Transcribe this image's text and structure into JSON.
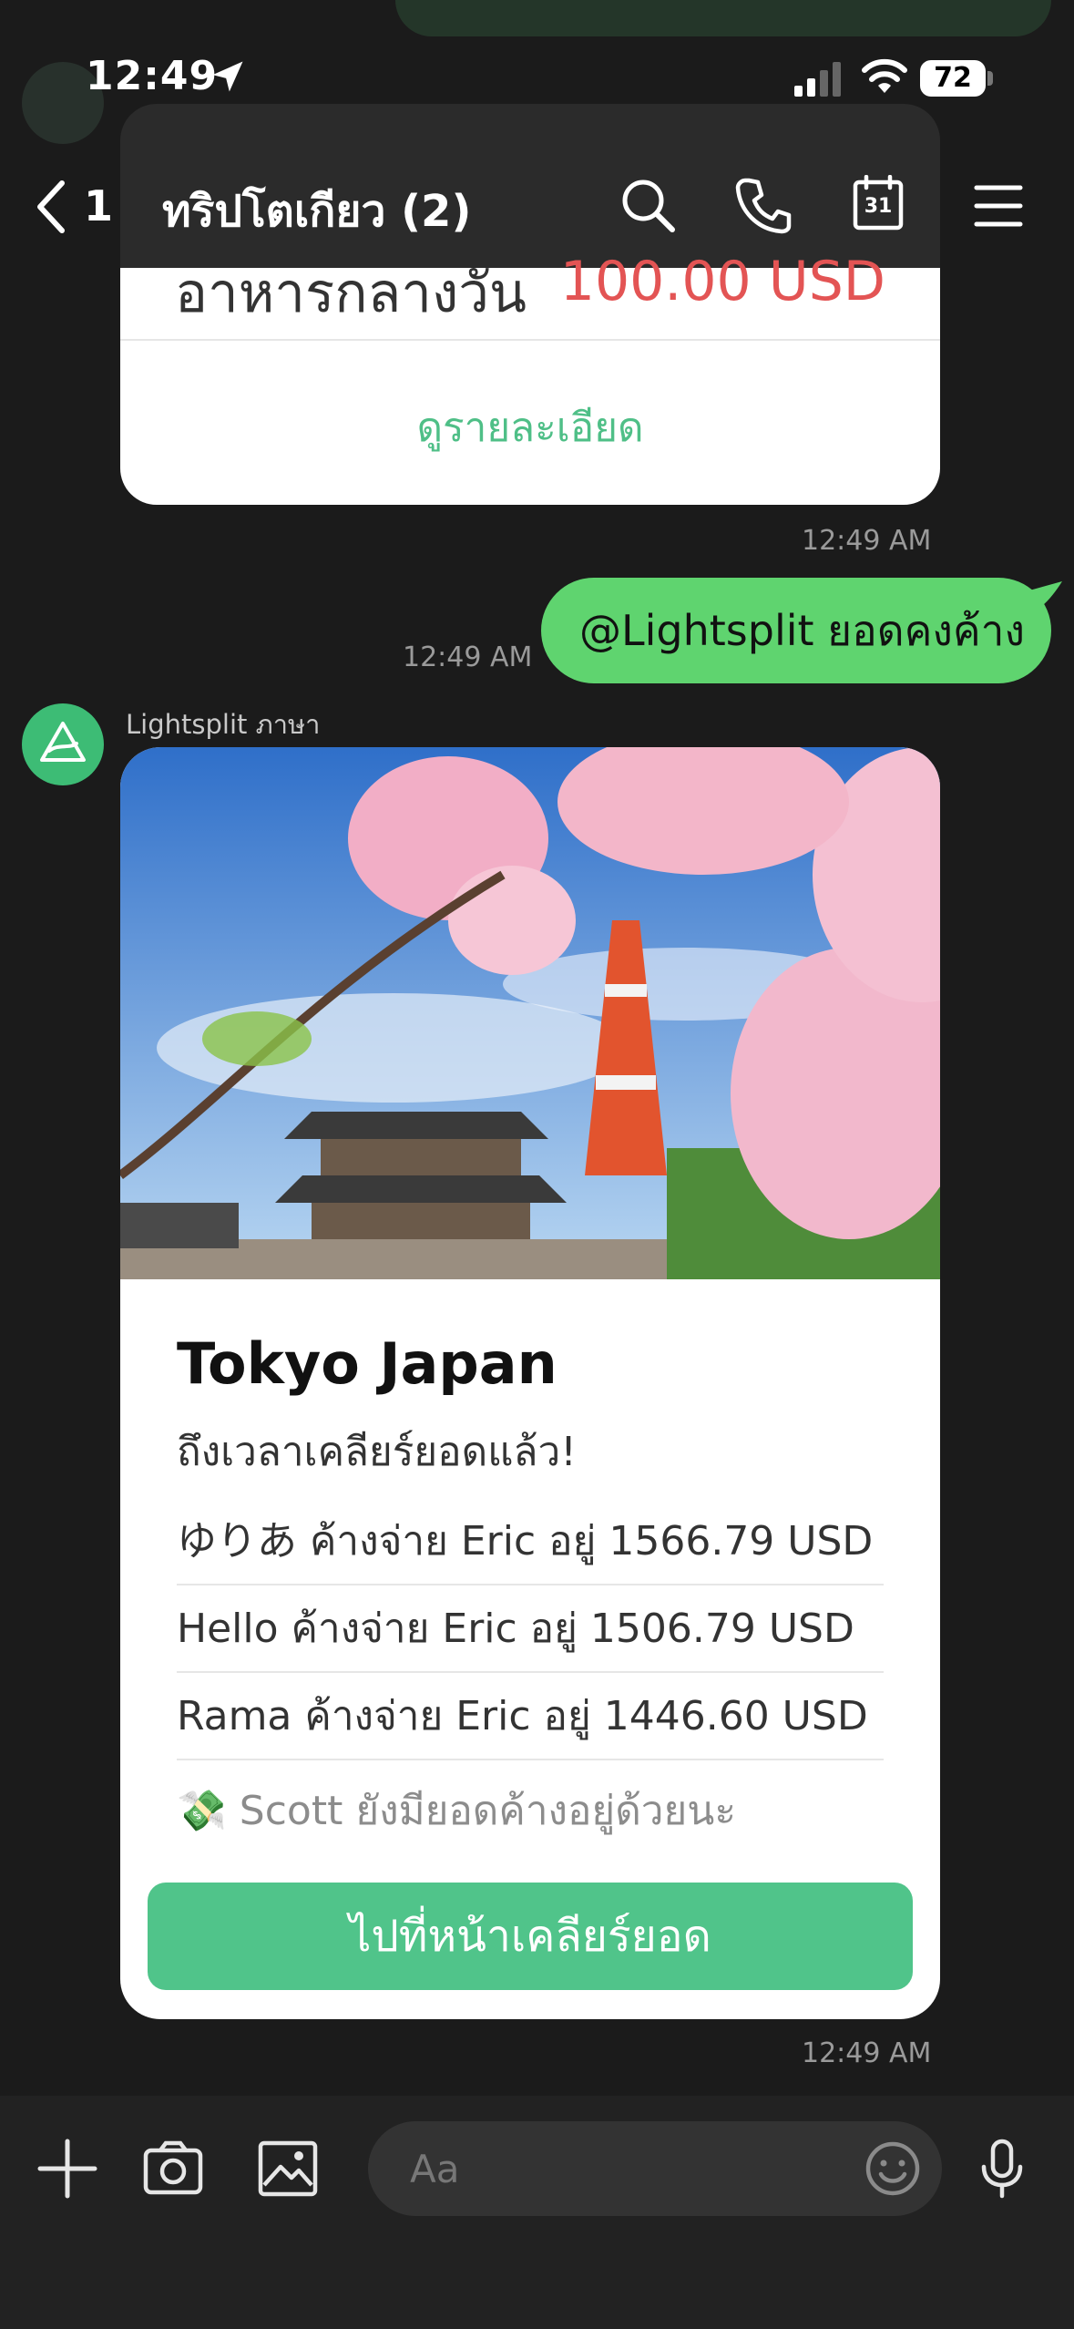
{
  "status_bar": {
    "time": "12:49",
    "battery": "72"
  },
  "header": {
    "back_count": "1",
    "title": "ทริปโตเกียว (2)",
    "calendar_day": "31"
  },
  "top_card": {
    "label": "อาหารกลางวัน",
    "amount": "100.00 USD",
    "link": "ดูรายละเอียด",
    "time": "12:49 AM"
  },
  "sent_message": {
    "text": "@Lightsplit ยอดคงค้าง",
    "time": "12:49 AM"
  },
  "bot": {
    "name": "Lightsplit ภาษา"
  },
  "card": {
    "title": "Tokyo Japan",
    "subtitle": "ถึงเวลาเคลียร์ยอดแล้ว!",
    "debts": [
      "ゆりあ ค้างจ่าย Eric อยู่ 1566.79 USD",
      "Hello ค้างจ่าย Eric อยู่ 1506.79 USD",
      "Rama ค้างจ่าย Eric อยู่ 1446.60 USD"
    ],
    "note_icon": "💸",
    "note": "Scott ยังมียอดค้างอยู่ด้วยนะ",
    "button": "ไปที่หน้าเคลียร์ยอด",
    "time": "12:49 AM"
  },
  "input": {
    "placeholder": "Aa"
  },
  "colors": {
    "accent": "#50c48a",
    "sent_bubble": "#5fd46f",
    "amount_red": "#e35454",
    "background": "#1b1b1b"
  }
}
